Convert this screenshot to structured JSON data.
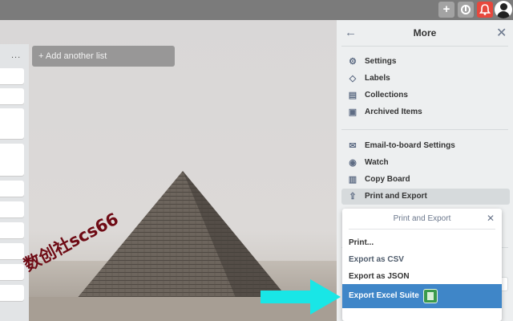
{
  "topbar": {
    "plus": "+",
    "info": "",
    "bell": ""
  },
  "board": {
    "list_menu": "...",
    "add_list_label": "+ Add another list",
    "watermark": "数创社scs66"
  },
  "sidebar": {
    "title": "More",
    "back": "←",
    "close": "✕",
    "group1": [
      {
        "icon": "gear-icon",
        "glyph": "⚙",
        "label": "Settings"
      },
      {
        "icon": "label-icon",
        "glyph": "◇",
        "label": "Labels"
      },
      {
        "icon": "collections-icon",
        "glyph": "▤",
        "label": "Collections"
      },
      {
        "icon": "archive-icon",
        "glyph": "▣",
        "label": "Archived Items"
      }
    ],
    "group2": [
      {
        "icon": "mail-icon",
        "glyph": "✉",
        "label": "Email-to-board Settings"
      },
      {
        "icon": "eye-icon",
        "glyph": "◉",
        "label": "Watch"
      },
      {
        "icon": "copy-board-icon",
        "glyph": "▥",
        "label": "Copy Board"
      },
      {
        "icon": "share-icon",
        "glyph": "⇪",
        "label": "Print and Export"
      }
    ]
  },
  "popover": {
    "title": "Print and Export",
    "close": "✕",
    "items": [
      "Print...",
      "Export as CSV",
      "Export as JSON"
    ],
    "highlight": "Export Excel Suite"
  },
  "colors": {
    "accent": "#3f86c8",
    "bell": "#e7483d",
    "arrow": "#19e6e6"
  }
}
